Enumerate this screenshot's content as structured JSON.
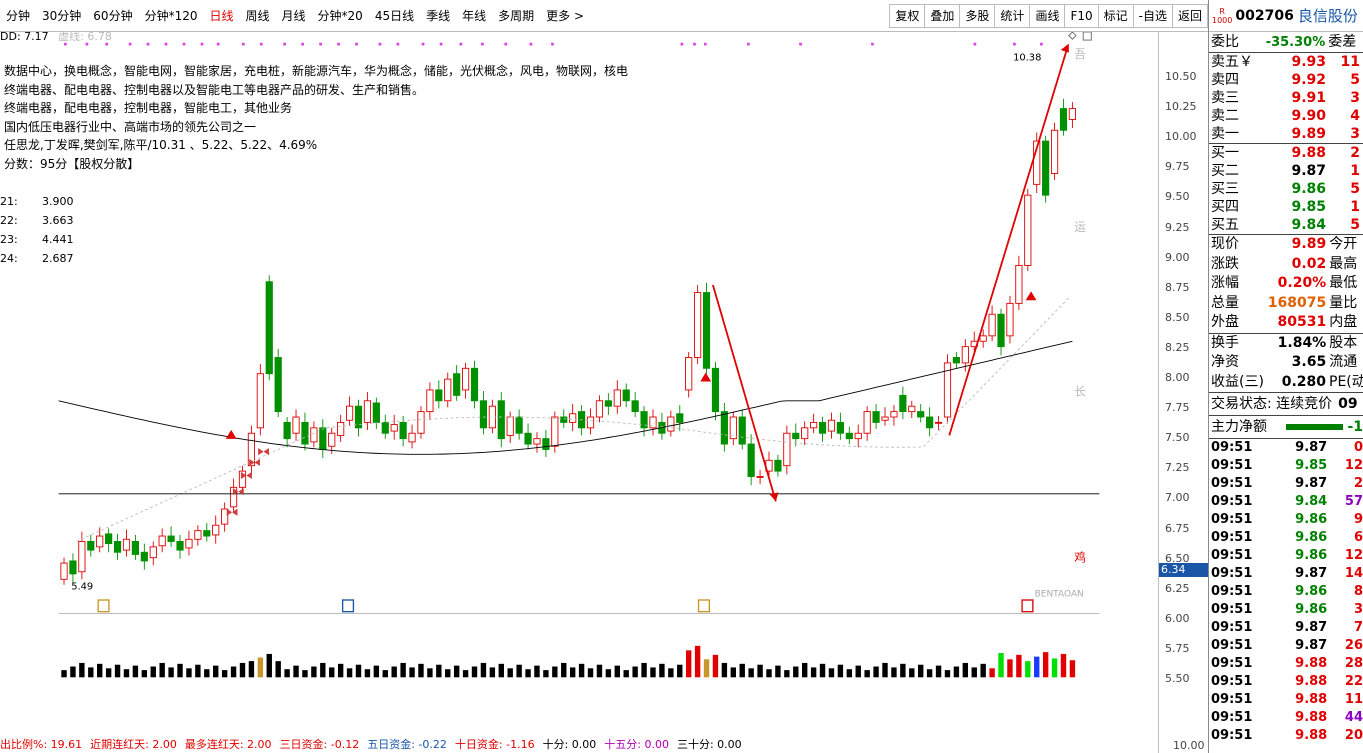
{
  "toolbar": {
    "periods": [
      "分钟",
      "30分钟",
      "60分钟",
      "分钟*120",
      "日线",
      "周线",
      "月线",
      "分钟*20",
      "45日线",
      "季线",
      "年线",
      "多周期",
      "更多 >"
    ],
    "active_period": "日线",
    "tools": [
      "复权",
      "叠加",
      "多股",
      "统计",
      "画线",
      "F10",
      "标记",
      "-自选",
      "返回"
    ]
  },
  "overlay": {
    "dd_label": "DD: 7.17",
    "virtual_label": "虚线: 6.78",
    "concepts": "数据中心，换电概念，智能电网，智能家居，充电桩，新能源汽车，华为概念，储能，光伏概念，风电，物联网，核电",
    "line2": "终端电器、配电电器、控制电器以及智能电工等电器产品的研发、生产和销售。",
    "line3": "终端电器，配电电器，控制电器，智能电工，其他业务",
    "line4": "国内低压电器行业中、高端市场的领先公司之一",
    "line5": "任思龙,丁发晖,樊剑军,陈平/10.31 、5.22、5.22、4.69%",
    "line6": "分数：95分【股权分散】",
    "stats": [
      {
        "k": "21:",
        "v": "3.900"
      },
      {
        "k": "22:",
        "v": "3.663"
      },
      {
        "k": "23:",
        "v": "4.441"
      },
      {
        "k": "24:",
        "v": "2.687"
      }
    ],
    "high_marker": "10.38",
    "low_marker": "5.49",
    "hline_label": "6.34",
    "watermark": "BENTAOAN",
    "side_chars": [
      "吾",
      "运",
      "长",
      "鸡"
    ]
  },
  "axis": {
    "ticks": [
      "10.50",
      "10.25",
      "10.00",
      "9.75",
      "9.50",
      "9.25",
      "9.00",
      "8.75",
      "8.50",
      "8.25",
      "8.00",
      "7.75",
      "7.50",
      "7.25",
      "7.00",
      "6.75",
      "6.50",
      "6.25",
      "6.00",
      "5.75",
      "5.50"
    ],
    "vol_tick": "10.00"
  },
  "bottom_stats": [
    {
      "t": "出比例%: 19.61",
      "c": "#e00000"
    },
    {
      "t": "近期连红天: 2.00",
      "c": "#e00000"
    },
    {
      "t": "最多连红天: 2.00",
      "c": "#e00000"
    },
    {
      "t": "三日资金: -0.12",
      "c": "#e00000"
    },
    {
      "t": "五日资金: -0.22",
      "c": "#1a56a8"
    },
    {
      "t": "十日资金: -1.16",
      "c": "#e00000"
    },
    {
      "t": "十分: 0.00",
      "c": "#000"
    },
    {
      "t": "十五分: 0.00",
      "c": "#b000b0"
    },
    {
      "t": "三十分: 0.00",
      "c": "#000"
    }
  ],
  "panel": {
    "code": "002706",
    "name": "良信股份",
    "badge_top": "R",
    "badge_bottom": "1000",
    "webi_label": "委比",
    "webi_value": "-35.30%",
    "webi_right": "委差",
    "asks": [
      {
        "l": "卖五￥",
        "p": "9.93",
        "q": "11"
      },
      {
        "l": "卖四",
        "p": "9.92",
        "q": "5"
      },
      {
        "l": "卖三",
        "p": "9.91",
        "q": "3"
      },
      {
        "l": "卖二",
        "p": "9.90",
        "q": "4"
      },
      {
        "l": "卖一",
        "p": "9.89",
        "q": "3"
      }
    ],
    "bids": [
      {
        "l": "买一",
        "p": "9.88",
        "q": "2",
        "c": "red"
      },
      {
        "l": "买二",
        "p": "9.87",
        "q": "1",
        "c": "blk"
      },
      {
        "l": "买三",
        "p": "9.86",
        "q": "5",
        "c": "green"
      },
      {
        "l": "买四",
        "p": "9.85",
        "q": "1",
        "c": "green"
      },
      {
        "l": "买五",
        "p": "9.84",
        "q": "5",
        "c": "green"
      }
    ],
    "info1": [
      {
        "l": "现价",
        "v": "9.89",
        "c": "red",
        "r": "今开"
      },
      {
        "l": "涨跌",
        "v": "0.02",
        "c": "red",
        "r": "最高"
      },
      {
        "l": "涨幅",
        "v": "0.20%",
        "c": "red",
        "r": "最低"
      },
      {
        "l": "总量",
        "v": "168075",
        "c": "orange",
        "r": "量比"
      },
      {
        "l": "外盘",
        "v": "80531",
        "c": "red",
        "r": "内盘"
      }
    ],
    "info2": [
      {
        "l": "换手",
        "v": "1.84%",
        "c": "blk",
        "r": "股本"
      },
      {
        "l": "净资",
        "v": "3.65",
        "c": "blk",
        "r": "流通"
      },
      {
        "l": "收益(三)",
        "v": "0.280",
        "c": "blk",
        "r": "PE(动"
      }
    ],
    "trade_status": "交易状态: 连续竞价",
    "trade_status_tail": "09",
    "main_net_label": "主力净额",
    "main_net_value": "-1",
    "ticks": [
      {
        "t": "09:51",
        "p": "9.87",
        "n": "0",
        "pc": "blk",
        "nc": "red"
      },
      {
        "t": "09:51",
        "p": "9.85",
        "n": "12",
        "pc": "green",
        "nc": "red"
      },
      {
        "t": "09:51",
        "p": "9.87",
        "n": "2",
        "pc": "blk",
        "nc": "red"
      },
      {
        "t": "09:51",
        "p": "9.84",
        "n": "57",
        "pc": "green",
        "nc": "purple"
      },
      {
        "t": "09:51",
        "p": "9.86",
        "n": "9",
        "pc": "green",
        "nc": "red"
      },
      {
        "t": "09:51",
        "p": "9.86",
        "n": "6",
        "pc": "green",
        "nc": "red"
      },
      {
        "t": "09:51",
        "p": "9.86",
        "n": "12",
        "pc": "green",
        "nc": "red"
      },
      {
        "t": "09:51",
        "p": "9.87",
        "n": "14",
        "pc": "blk",
        "nc": "red"
      },
      {
        "t": "09:51",
        "p": "9.86",
        "n": "8",
        "pc": "green",
        "nc": "red"
      },
      {
        "t": "09:51",
        "p": "9.86",
        "n": "3",
        "pc": "green",
        "nc": "red"
      },
      {
        "t": "09:51",
        "p": "9.87",
        "n": "7",
        "pc": "blk",
        "nc": "red"
      },
      {
        "t": "09:51",
        "p": "9.87",
        "n": "26",
        "pc": "blk",
        "nc": "red"
      },
      {
        "t": "09:51",
        "p": "9.88",
        "n": "28",
        "pc": "red",
        "nc": "red"
      },
      {
        "t": "09:51",
        "p": "9.88",
        "n": "22",
        "pc": "red",
        "nc": "red"
      },
      {
        "t": "09:51",
        "p": "9.88",
        "n": "11",
        "pc": "red",
        "nc": "red"
      },
      {
        "t": "09:51",
        "p": "9.88",
        "n": "44",
        "pc": "red",
        "nc": "purple"
      },
      {
        "t": "09:51",
        "p": "9.88",
        "n": "20",
        "pc": "red",
        "nc": "red"
      }
    ]
  },
  "colors": {
    "up": "#e00000",
    "down": "#009000",
    "accent": "#1a56a8"
  }
}
